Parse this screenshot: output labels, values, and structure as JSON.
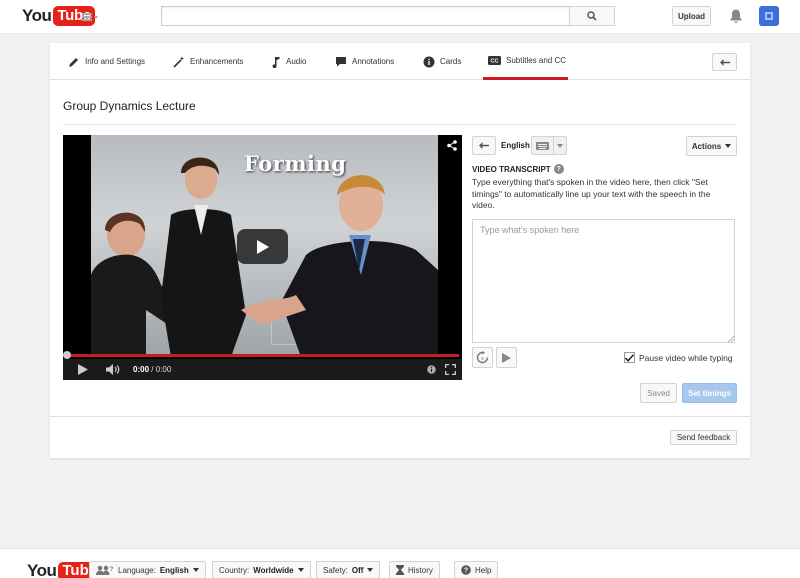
{
  "masthead": {
    "logo_you": "You",
    "logo_tube": "Tube",
    "search_placeholder": "",
    "upload_label": "Upload"
  },
  "tabs": [
    {
      "label": "Info and Settings",
      "icon": "pencil-icon",
      "active": false
    },
    {
      "label": "Enhancements",
      "icon": "magic-wand-icon",
      "active": false
    },
    {
      "label": "Audio",
      "icon": "music-note-icon",
      "active": false
    },
    {
      "label": "Annotations",
      "icon": "speech-bubble-icon",
      "active": false
    },
    {
      "label": "Cards",
      "icon": "info-circle-icon",
      "active": false
    },
    {
      "label": "Subtitles and CC",
      "icon": "cc-icon",
      "active": true
    }
  ],
  "video": {
    "title": "Group Dynamics Lecture",
    "scene_text": "Forming",
    "time_current": "0:00",
    "time_total": "/ 0:00",
    "progress": 0
  },
  "subtitles": {
    "language": "English",
    "actions_label": "Actions",
    "transcript_label": "VIDEO TRANSCRIPT",
    "help_glyph": "?",
    "transcript_desc": "Type everything that's spoken in the video here, then click \"Set timings\" to automatically line up your text with the speech in the video.",
    "transcript_placeholder": "Type what's spoken here",
    "pause_label": "Pause video while typing",
    "pause_checked": true,
    "saved_label": "Saved",
    "set_timings_label": "Set timings"
  },
  "feedback_label": "Send feedback",
  "footer": {
    "logo_you": "You",
    "logo_tube": "Tube",
    "language_prefix": "Language:",
    "language_value": "English",
    "country_prefix": "Country:",
    "country_value": "Worldwide",
    "safety_prefix": "Safety:",
    "safety_value": "Off",
    "history_label": "History",
    "help_label": "Help"
  },
  "colors": {
    "brand_red": "#e62117",
    "active_tab": "#cc181e",
    "primary_button": "#a6c8ec"
  }
}
